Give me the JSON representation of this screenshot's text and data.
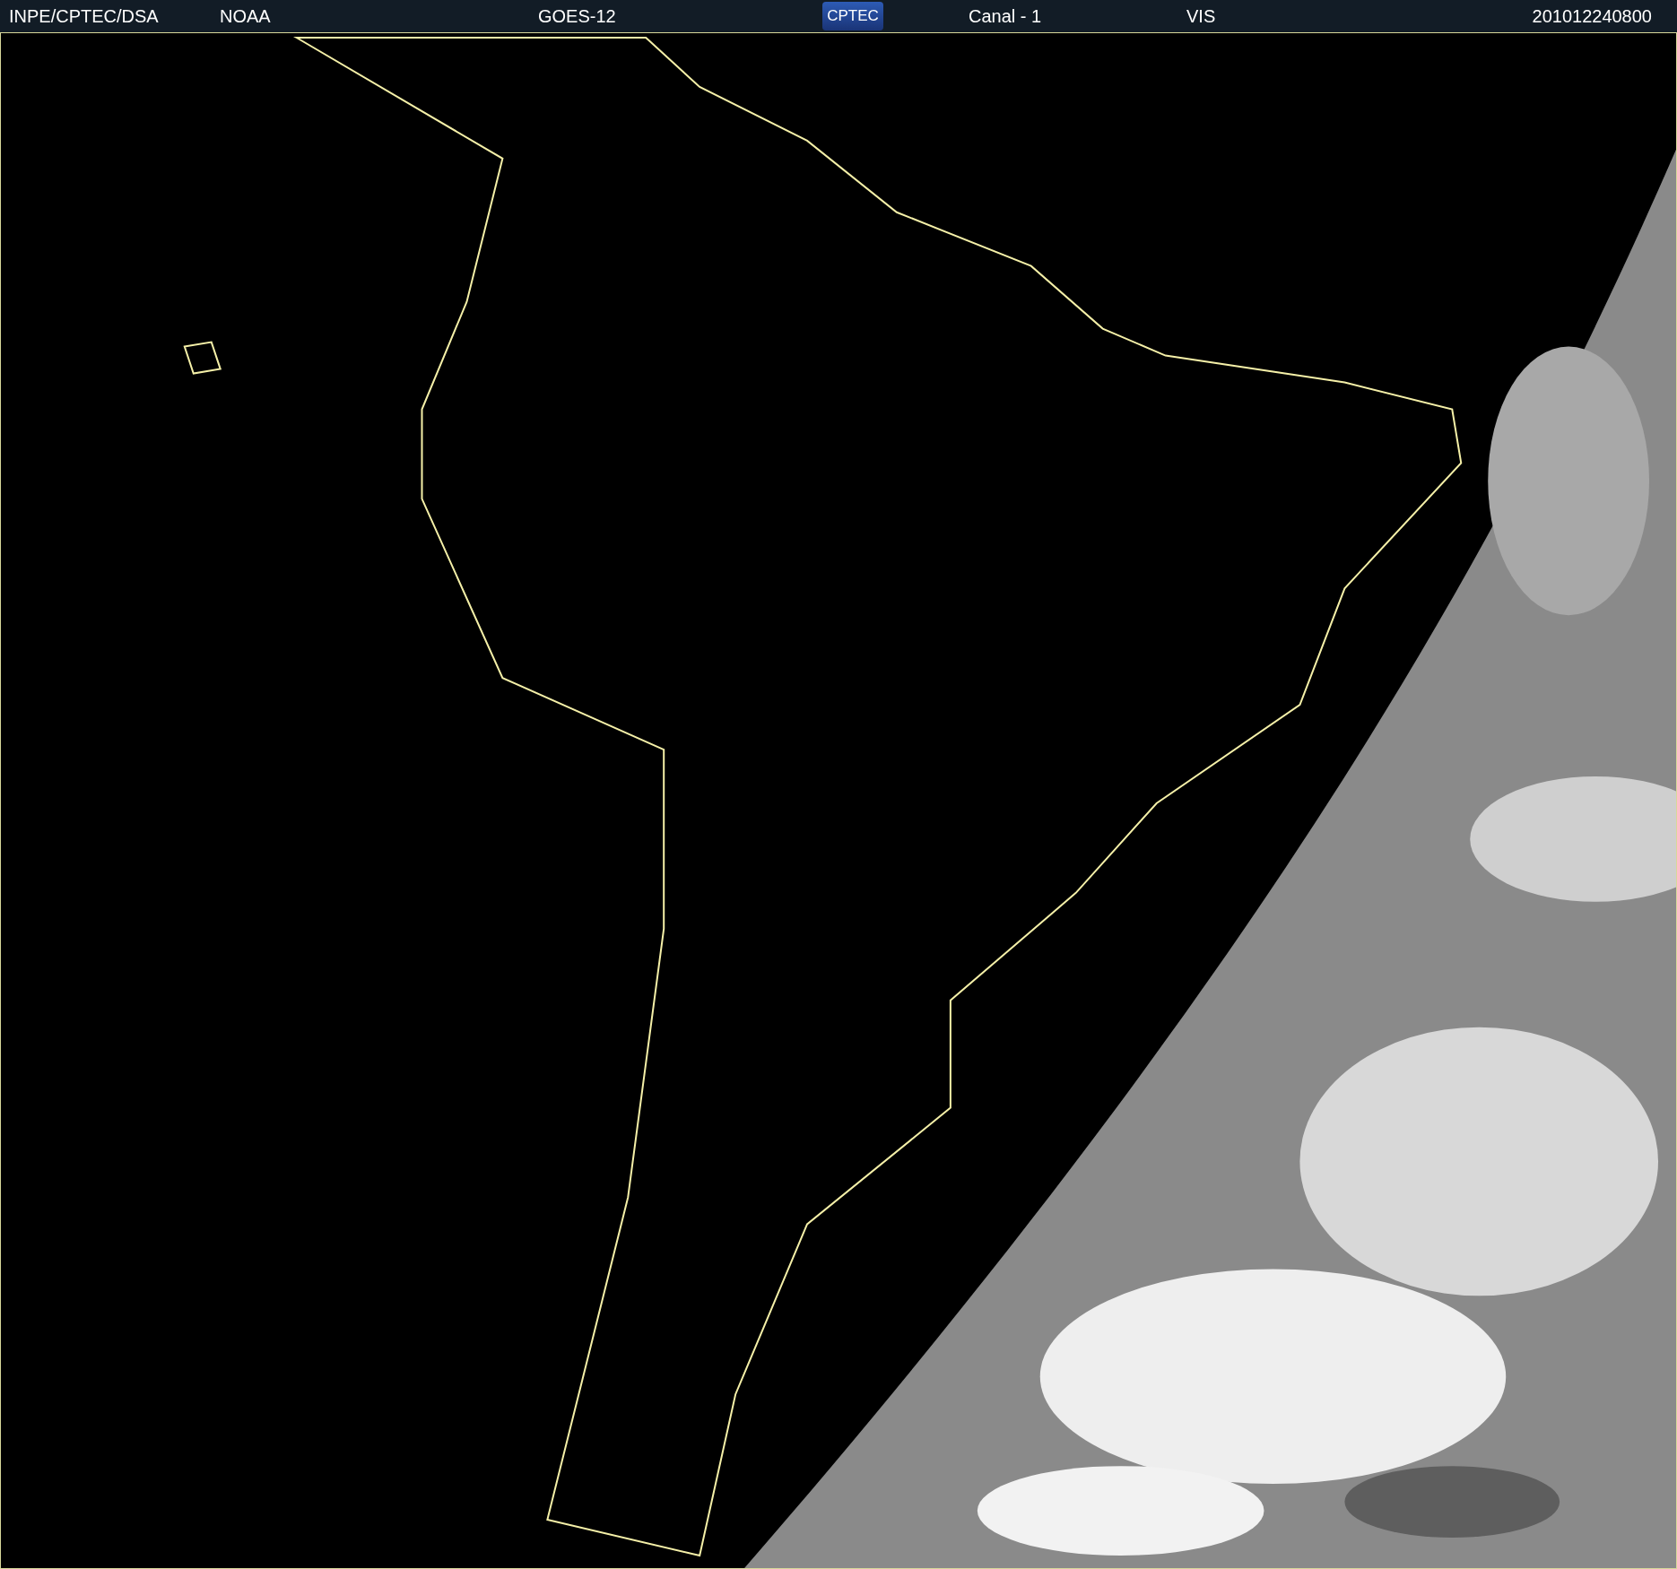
{
  "header": {
    "left": [
      "INPE/CPTEC/DSA",
      "NOAA"
    ],
    "satellite": "GOES-12",
    "logo": "CPTEC",
    "channel": "Canal - 1",
    "band": "VIS",
    "timestamp": "201012240800"
  }
}
